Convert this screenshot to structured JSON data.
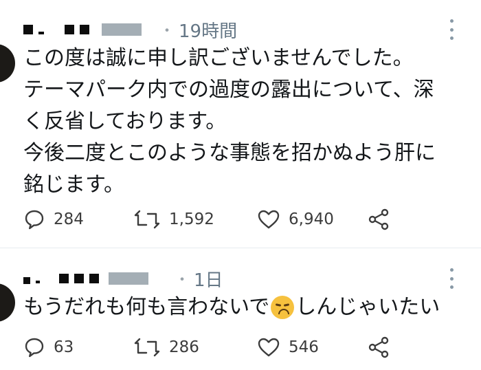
{
  "tweets": [
    {
      "time": "19時間",
      "lines": [
        "この度は誠に申し訳ございませんでした。",
        "テーマパーク内での過度の露出について、深",
        "く反省しております。",
        "今後二度とこのような事態を招かぬよう肝に",
        "銘じます。"
      ],
      "replies": "284",
      "retweets": "1,592",
      "likes": "6,940"
    },
    {
      "time": "1日",
      "text_before": "もうだれも何も言わないで",
      "emoji": "disappointed-face",
      "text_after": "しんじゃいたい",
      "replies": "63",
      "retweets": "286",
      "likes": "546"
    }
  ]
}
